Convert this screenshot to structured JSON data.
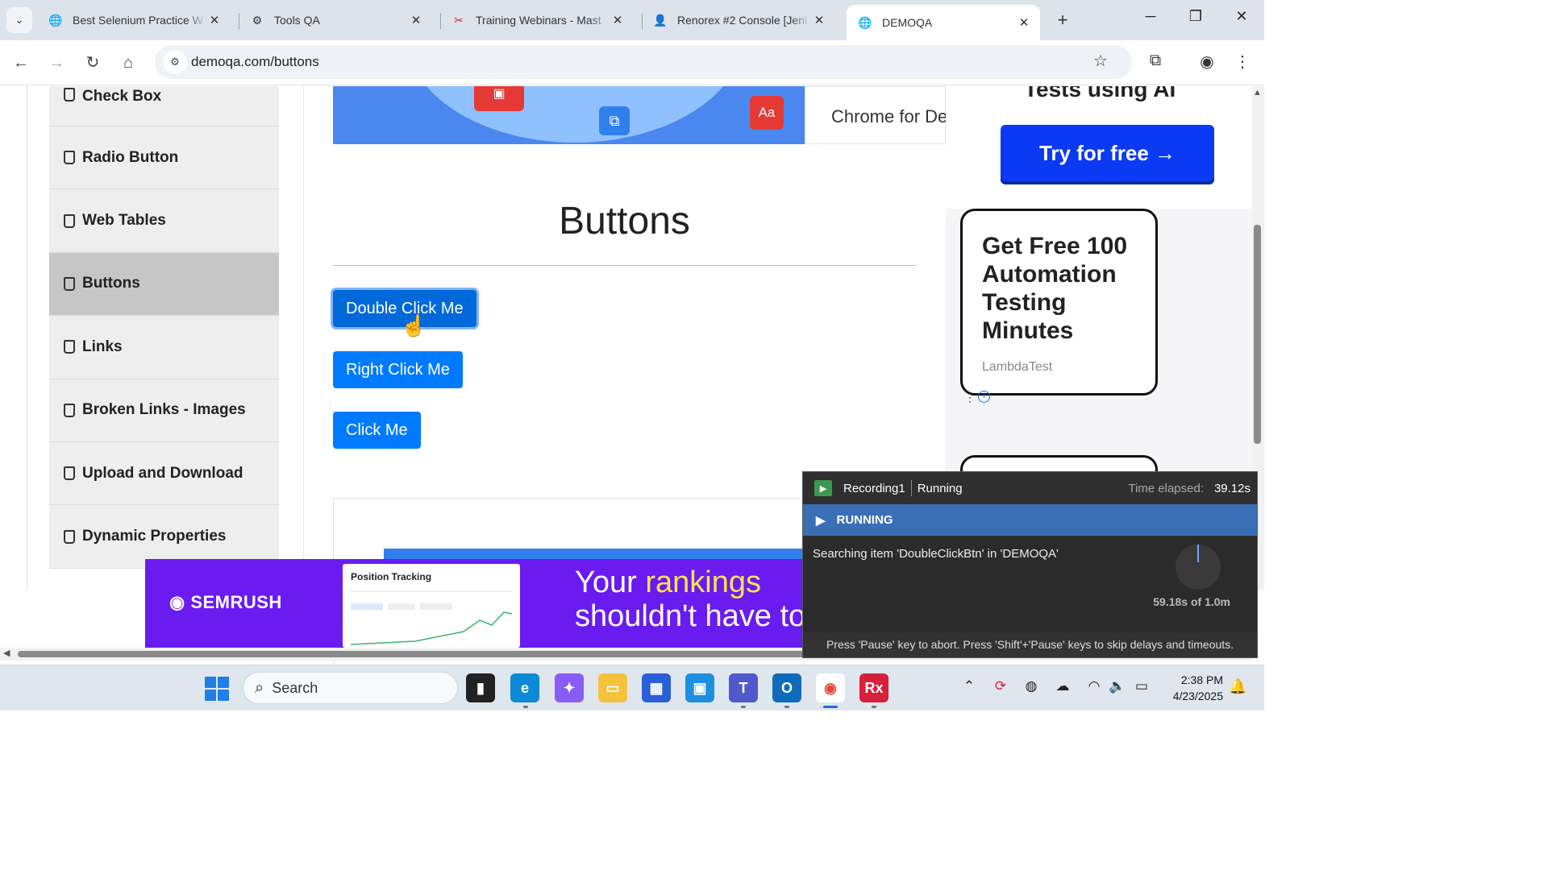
{
  "browser": {
    "tabs": [
      {
        "title": "Best Selenium Practice W",
        "icon": "globe-icon"
      },
      {
        "title": "Tools QA",
        "icon": "gear-icon"
      },
      {
        "title": "Training Webinars - Mast",
        "icon": "ranorex-icon"
      },
      {
        "title": "Renorex #2 Console [Jenl",
        "icon": "jenkins-icon"
      },
      {
        "title": "DEMOQA",
        "icon": "globe-icon"
      }
    ],
    "url": "demoqa.com/buttons"
  },
  "sidebar": {
    "items": [
      {
        "label": "Check Box"
      },
      {
        "label": "Radio Button"
      },
      {
        "label": "Web Tables"
      },
      {
        "label": "Buttons"
      },
      {
        "label": "Links"
      },
      {
        "label": "Broken Links - Images"
      },
      {
        "label": "Upload and Download"
      },
      {
        "label": "Dynamic Properties"
      }
    ],
    "selected": "Buttons"
  },
  "ads": {
    "top_banner_text": "Chrome for De",
    "right_headline": "Tests using AI",
    "try_button": "Try for free →",
    "lt_title": "Get Free 100 Automation Testing Minutes",
    "lt_brand": "LambdaTest",
    "bottom_logo": "SEMRUSH",
    "bottom_shot_title": "Position Tracking",
    "bottom_headline_1": "Your ",
    "bottom_headline_highlight": "rankings",
    "bottom_headline_2": "shouldn't have to"
  },
  "main": {
    "title": "Buttons",
    "double_click_label": "Double Click Me",
    "right_click_label": "Right Click Me",
    "click_label": "Click Me"
  },
  "recorder": {
    "name": "Recording1",
    "status": "Running",
    "elapsed_label": "Time elapsed:",
    "elapsed": "39.12s",
    "state": "RUNNING",
    "message": "Searching item 'DoubleClickBtn' in 'DEMOQA'",
    "timer": "59.18s of 1.0m",
    "footer": "Press 'Pause' key to abort. Press 'Shift'+'Pause' keys to skip delays and timeouts."
  },
  "taskbar": {
    "search_placeholder": "Search",
    "time": "2:38 PM",
    "date": "4/23/2025"
  },
  "colors": {
    "button_blue": "#007bff",
    "menu_selected": "#c6c6c6",
    "recorder_state": "#3a6fb5",
    "semrush_purple": "#6a1bf0"
  }
}
